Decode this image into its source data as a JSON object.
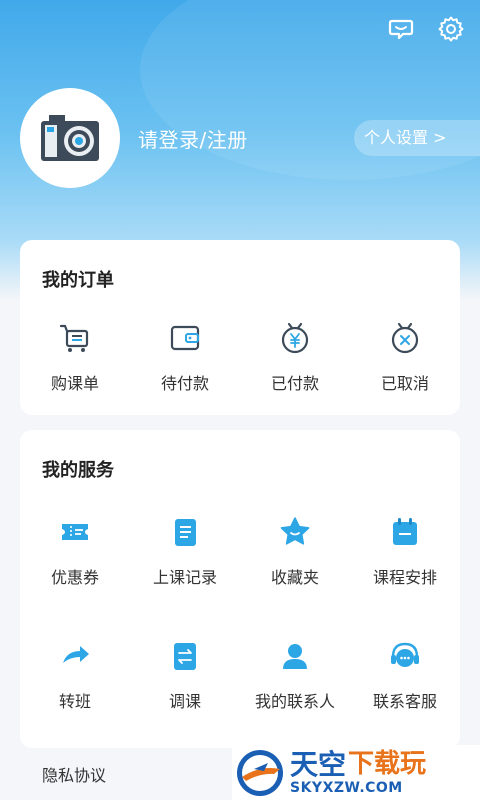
{
  "header": {
    "login_label": "请登录/注册",
    "profile_settings_label": "个人设置 >",
    "icons": [
      "message-icon",
      "gear-icon"
    ]
  },
  "orders": {
    "title": "我的订单",
    "items": [
      {
        "label": "购课单",
        "icon": "cart-icon"
      },
      {
        "label": "待付款",
        "icon": "wallet-icon"
      },
      {
        "label": "已付款",
        "icon": "paid-icon"
      },
      {
        "label": "已取消",
        "icon": "cancelled-icon"
      }
    ]
  },
  "services": {
    "title": "我的服务",
    "items": [
      {
        "label": "优惠券",
        "icon": "coupon-icon"
      },
      {
        "label": "上课记录",
        "icon": "record-icon"
      },
      {
        "label": "收藏夹",
        "icon": "star-icon"
      },
      {
        "label": "课程安排",
        "icon": "calendar-icon"
      },
      {
        "label": "转班",
        "icon": "transfer-icon"
      },
      {
        "label": "调课",
        "icon": "swap-icon"
      },
      {
        "label": "我的联系人",
        "icon": "contact-icon"
      },
      {
        "label": "联系客服",
        "icon": "support-icon"
      }
    ]
  },
  "footer": {
    "privacy_label": "隐私协议"
  },
  "watermark": {
    "main": "天空",
    "sub": "下载玩",
    "url": "SKYXZW.COM"
  },
  "colors": {
    "accent": "#2196f3",
    "hero_top": "#41a9ea",
    "icon_dark": "#3d4a59"
  }
}
